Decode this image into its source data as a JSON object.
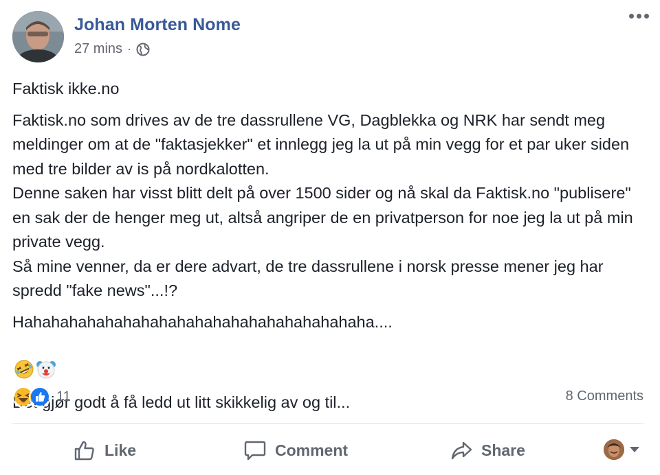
{
  "post": {
    "author": "Johan Morten Nome",
    "time": "27 mins",
    "separator": "·",
    "privacy_icon": "globe-icon",
    "more_icon": "more-options-icon",
    "paragraphs": [
      "Faktisk ikke.no",
      "Faktisk.no som drives av de tre dassrullene VG, Dagblekka og NRK har sendt meg meldinger om at de \"faktasjekker\" et innlegg jeg la ut på min vegg for et par uker siden med tre bilder av is på nordkalotten.\nDenne saken har visst blitt delt på over 1500 sider og nå skal da Faktisk.no \"publisere\" en sak der de henger meg ut, altså angriper de en privatperson for noe jeg la ut på min private vegg.\nSå mine venner, da er dere advart, de tre dassrullene i norsk presse mener jeg har spredd \"fake news\"...!?",
      "Hahahahahahahahahahahahahahahahahahahaha....",
      "Det gjør godt å få ledd ut litt skikkelig av og til..."
    ],
    "laugh_line_emojis": [
      "rolling-on-floor-laughing-emoji",
      "clown-face-emoji"
    ]
  },
  "reactions": {
    "icons": [
      "haha-reaction-icon",
      "like-reaction-icon"
    ],
    "count": "11",
    "comments": "8 Comments"
  },
  "actions": {
    "like": "Like",
    "comment": "Comment",
    "share": "Share"
  },
  "colors": {
    "author": "#385898",
    "meta": "#616770",
    "text": "#1d2129",
    "action": "#606770",
    "like_blue": "#1877f2",
    "haha_yellow": "#f7b928",
    "divider": "#dadde1"
  }
}
